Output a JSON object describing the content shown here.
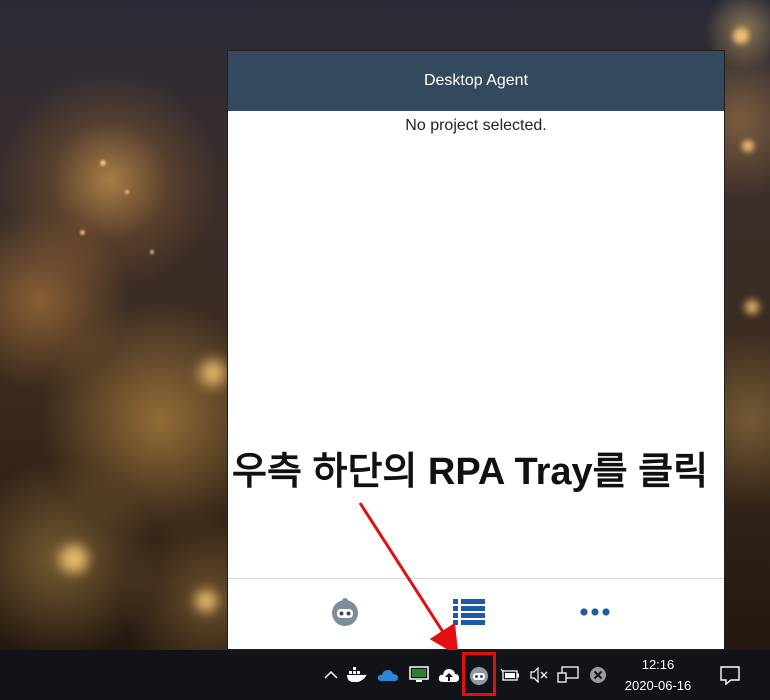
{
  "agent": {
    "title": "Desktop Agent",
    "status": "No project selected."
  },
  "footer": {
    "buttons": [
      "robot-icon",
      "list-icon",
      "more-icon"
    ]
  },
  "annotation": {
    "text": "우측 하단의 RPA Tray를 클릭",
    "highlight_color": "#e01010"
  },
  "taskbar": {
    "tray_icons": [
      "chevron-up-icon",
      "docker-icon",
      "onedrive-icon",
      "monitor-icon",
      "cloud-upload-icon",
      "rpa-tray-icon",
      "battery-icon",
      "volume-muted-icon",
      "network-icon",
      "close-circle-icon"
    ],
    "time": "12:16",
    "date": "2020-06-16"
  },
  "colors": {
    "header_bg": "#34495e",
    "icon_blue": "#1f5aa6",
    "taskbar_bg": "#111318"
  }
}
